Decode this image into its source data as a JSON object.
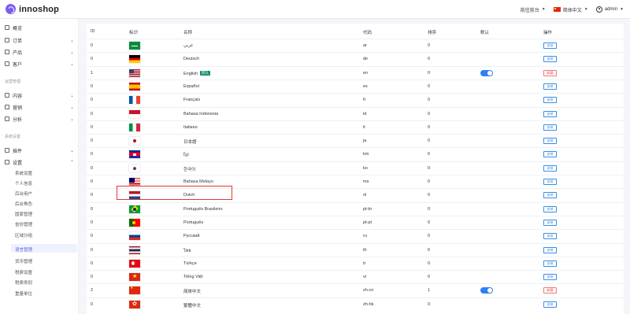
{
  "header": {
    "brand": "innoshop",
    "links": [
      {
        "label": "前往前台",
        "icon": "chevron-down-icon"
      },
      {
        "label": "简体中文",
        "icon": "flag-cn-icon"
      },
      {
        "label": "admin",
        "icon": "user-icon"
      }
    ]
  },
  "sidebar": {
    "top_items": [
      {
        "label": "概览",
        "icon": "home-icon",
        "chevron": false
      },
      {
        "label": "订单",
        "icon": "cart-icon",
        "chevron": true
      },
      {
        "label": "产品",
        "icon": "box-icon",
        "chevron": true
      },
      {
        "label": "客户",
        "icon": "users-icon",
        "chevron": true
      }
    ],
    "sections": [
      {
        "title": "运营管理",
        "items": [
          {
            "label": "内容",
            "icon": "file-icon"
          },
          {
            "label": "营销",
            "icon": "megaphone-icon"
          },
          {
            "label": "分析",
            "icon": "chart-icon"
          }
        ]
      },
      {
        "title": "系统设置",
        "items": [
          {
            "label": "插件",
            "icon": "puzzle-icon"
          },
          {
            "label": "设置",
            "icon": "gear-icon"
          }
        ]
      }
    ],
    "settings_sub": [
      "系统设置",
      "个人信息",
      "后台用户",
      "后台角色",
      "国家管理",
      "省份管理",
      "区域分组",
      "语言管理",
      "货币管理",
      "税费设置",
      "税费类别",
      "重量单位"
    ],
    "active_sub": "语言管理"
  },
  "table": {
    "headers": [
      "ID",
      "标识",
      "名称",
      "代码",
      "排序",
      "默认",
      "操作"
    ],
    "rows": [
      {
        "id": "0",
        "flag": "f-sa",
        "name": "عربي",
        "code": "ar",
        "sort": "0",
        "default": false,
        "action": "安装"
      },
      {
        "id": "0",
        "flag": "f-de",
        "name": "Deutsch",
        "code": "de",
        "sort": "0",
        "default": false,
        "action": "安装"
      },
      {
        "id": "1",
        "flag": "f-us",
        "name": "English",
        "tag": "默认",
        "code": "en",
        "sort": "0",
        "default": true,
        "action": "卸载"
      },
      {
        "id": "0",
        "flag": "f-es",
        "name": "Español",
        "code": "es",
        "sort": "0",
        "default": false,
        "action": "安装"
      },
      {
        "id": "0",
        "flag": "f-fr",
        "name": "Français",
        "code": "fr",
        "sort": "0",
        "default": false,
        "action": "安装"
      },
      {
        "id": "0",
        "flag": "f-id",
        "name": "Bahasa Indonesia",
        "code": "id",
        "sort": "0",
        "default": false,
        "action": "安装"
      },
      {
        "id": "0",
        "flag": "f-it",
        "name": "Italiano",
        "code": "it",
        "sort": "0",
        "default": false,
        "action": "安装"
      },
      {
        "id": "0",
        "flag": "f-jp",
        "name": "日本語",
        "code": "ja",
        "sort": "0",
        "default": false,
        "action": "安装"
      },
      {
        "id": "0",
        "flag": "f-kh",
        "name": "ខ្មែរ",
        "code": "km",
        "sort": "0",
        "default": false,
        "action": "安装"
      },
      {
        "id": "0",
        "flag": "f-kr",
        "name": "한국어",
        "code": "ko",
        "sort": "0",
        "default": false,
        "action": "安装"
      },
      {
        "id": "0",
        "flag": "f-my",
        "name": "Bahasa Melayu",
        "code": "ms",
        "sort": "0",
        "default": false,
        "action": "安装"
      },
      {
        "id": "0",
        "flag": "f-nl",
        "name": "Dutch",
        "code": "nl",
        "sort": "0",
        "default": false,
        "action": "安装"
      },
      {
        "id": "0",
        "flag": "f-br",
        "name": "Português Brasileiro",
        "code": "pt-br",
        "sort": "0",
        "default": false,
        "action": "安装"
      },
      {
        "id": "0",
        "flag": "f-pt",
        "name": "Português",
        "code": "pt-pt",
        "sort": "0",
        "default": false,
        "action": "安装"
      },
      {
        "id": "0",
        "flag": "f-ru",
        "name": "Русский",
        "code": "ru",
        "sort": "0",
        "default": false,
        "action": "安装"
      },
      {
        "id": "0",
        "flag": "f-th",
        "name": "ไทย",
        "code": "th",
        "sort": "0",
        "default": false,
        "action": "安装"
      },
      {
        "id": "0",
        "flag": "f-tr",
        "name": "Türkçe",
        "code": "tr",
        "sort": "0",
        "default": false,
        "action": "安装"
      },
      {
        "id": "0",
        "flag": "f-vn",
        "name": "Tiếng Việt",
        "code": "vi",
        "sort": "0",
        "default": false,
        "action": "安装"
      },
      {
        "id": "2",
        "flag": "f-cn",
        "name": "简体中文",
        "code": "zh-cn",
        "sort": "1",
        "default": true,
        "action": "卸载"
      },
      {
        "id": "0",
        "flag": "f-hk",
        "name": "繁體中文",
        "code": "zh-hk",
        "sort": "0",
        "default": false,
        "action": "安装"
      }
    ]
  },
  "colors": {
    "accent": "#2f7ff5",
    "brand": "#7d5cf0",
    "danger": "#e05555",
    "tag": "#0d8c6c",
    "highlight": "#e53935"
  }
}
